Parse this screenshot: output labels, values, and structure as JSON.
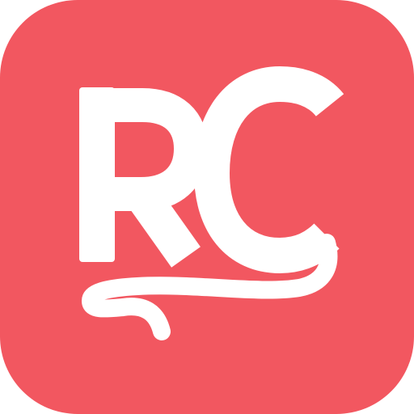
{
  "icon": {
    "name": "RC",
    "logo_text": "RC",
    "colors": {
      "background": "#F25760",
      "foreground": "#FFFFFF"
    }
  }
}
